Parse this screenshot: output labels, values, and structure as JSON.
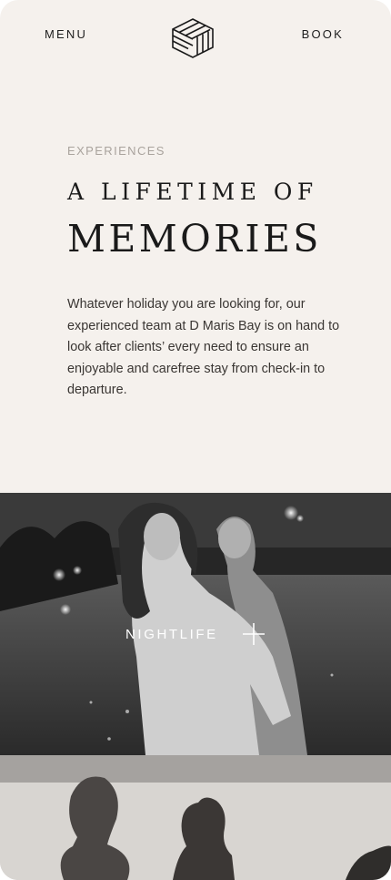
{
  "header": {
    "menu_label": "MENU",
    "book_label": "BOOK",
    "logo_icon": "cube-logo-icon"
  },
  "intro": {
    "eyebrow": "EXPERIENCES",
    "headline_line1": "A LIFETIME OF",
    "headline_line2": "MEMORIES",
    "body": "Whatever holiday you are looking for, our experienced team at D Maris Bay is on hand to look after clients’ every need to ensure an enjoyable and carefree stay from check-in to departure."
  },
  "cards": [
    {
      "label": "NIGHTLIFE",
      "icon": "plus-icon"
    },
    {
      "label": ""
    }
  ],
  "colors": {
    "page_background": "#f5f1ed",
    "text_dark": "#1a1a1a",
    "eyebrow_grey": "#a9a39d"
  }
}
